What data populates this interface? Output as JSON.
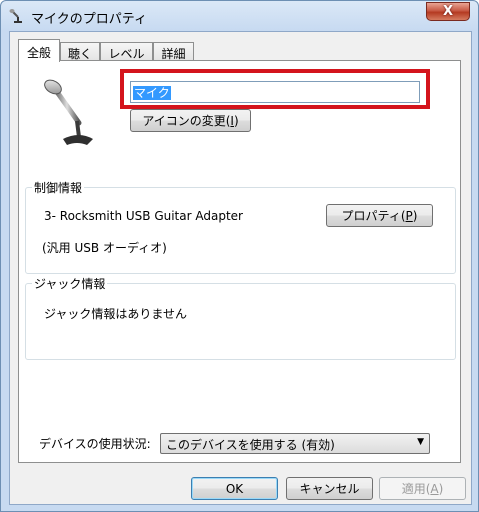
{
  "window": {
    "title": "マイクのプロパティ",
    "close_label": "X"
  },
  "tabs": [
    {
      "label": "全般",
      "active": true
    },
    {
      "label": "聴く",
      "active": false
    },
    {
      "label": "レベル",
      "active": false
    },
    {
      "label": "詳細",
      "active": false
    }
  ],
  "general": {
    "device_name_value": "マイク",
    "change_icon_button": "アイコンの変更(",
    "change_icon_key": "I",
    "change_icon_suffix": ")",
    "control_info": {
      "label": "制御情報",
      "device": "3- Rocksmith USB Guitar Adapter",
      "driver": "(汎用 USB オーディオ)",
      "properties_button": "プロパティ(",
      "properties_key": "P",
      "properties_suffix": ")"
    },
    "jack_info": {
      "label": "ジャック情報",
      "text": "ジャック情報はありません"
    },
    "usage": {
      "label": "デバイスの使用状況:",
      "selected": "このデバイスを使用する (有効)"
    }
  },
  "footer": {
    "ok": "OK",
    "cancel": "キャンセル",
    "apply": "適用(",
    "apply_key": "A",
    "apply_suffix": ")"
  },
  "colors": {
    "highlight_box": "#d4141c",
    "selection": "#3399ff"
  }
}
